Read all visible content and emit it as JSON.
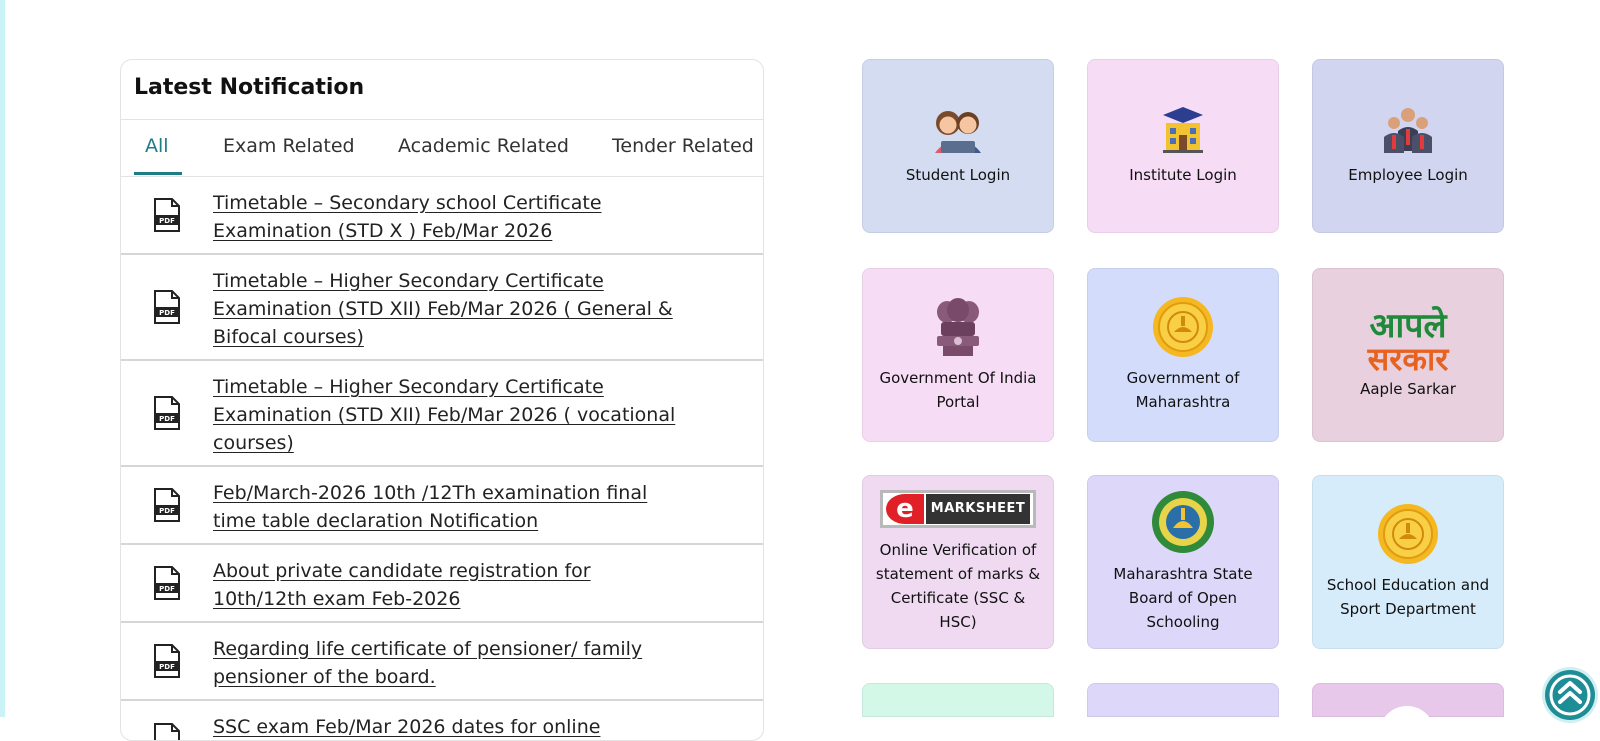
{
  "notifications": {
    "title": "Latest Notification",
    "tabs": [
      "All",
      "Exam Related",
      "Academic Related",
      "Tender Related"
    ],
    "items": [
      "Timetable – Secondary school Certificate Examination (STD X ) Feb/Mar 2026",
      "Timetable – Higher Secondary Certificate Examination (STD XII) Feb/Mar 2026 ( General & Bifocal courses)",
      "Timetable – Higher Secondary Certificate Examination (STD XII) Feb/Mar 2026 ( vocational courses)",
      "Feb/March-2026 10th /12Th examination final time table declaration Notification",
      "About private candidate registration for 10th/12th exam Feb-2026",
      "Regarding life certificate of pensioner/ family pensioner of the board.",
      "SSC exam Feb/Mar 2026 dates for online"
    ],
    "item_icon": "pdf-icon"
  },
  "tiles": {
    "student": {
      "label": "Student Login",
      "icon": "students-icon",
      "bg": "#d3dcf0"
    },
    "institute": {
      "label": "Institute Login",
      "icon": "institute-building-icon",
      "bg": "#f6dcf5"
    },
    "employee": {
      "label": "Employee Login",
      "icon": "employees-icon",
      "bg": "#d2d5f0"
    },
    "goi": {
      "label": "Government Of India Portal",
      "icon": "national-emblem-icon",
      "bg": "#f6dcf5"
    },
    "gom": {
      "label": "Government of Maharashtra",
      "icon": "maharashtra-seal-icon",
      "bg": "#d3ddfb"
    },
    "aaple": {
      "label": "Aaple Sarkar",
      "icon": "aaple-sarkar-logo",
      "logo_top": "आपले",
      "logo_bottom": "सरकार",
      "bg": "#e8d0de"
    },
    "emarksheet": {
      "label": "Online Verification of statement of marks & Certificate (SSC & HSC)",
      "icon": "emarksheet-logo",
      "logo_text": "MARKSHEET",
      "bg": "#efdaf1"
    },
    "msbos": {
      "label": "Maharashtra State Board of Open Schooling",
      "icon": "msbos-seal-icon",
      "bg": "#ddd7f9"
    },
    "sed": {
      "label": "School Education and Sport Department",
      "icon": "maharashtra-seal-icon",
      "bg": "#d6ecfa"
    }
  },
  "colors": {
    "accent": "#1c7d87",
    "scroll_button": "#1f8d96"
  }
}
